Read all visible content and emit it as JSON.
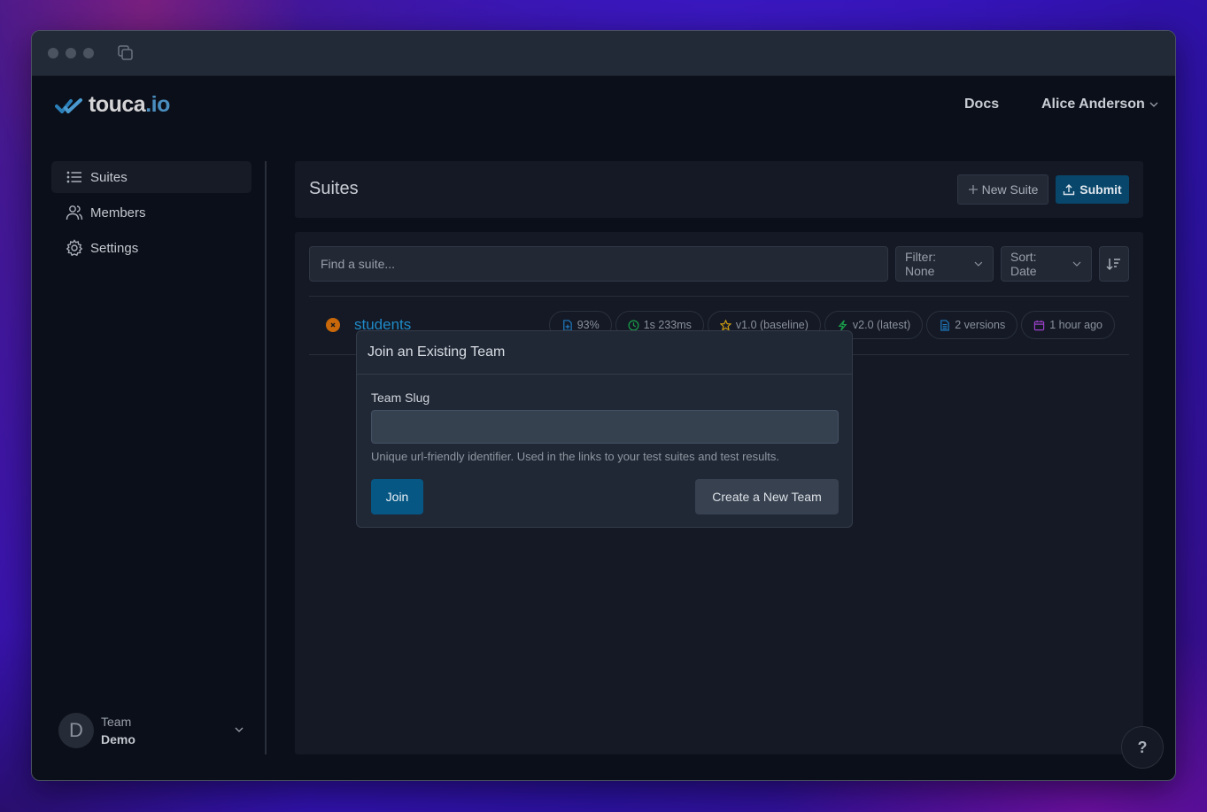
{
  "app": {
    "logo_word": "touca",
    "logo_tld": ".io"
  },
  "topnav": {
    "docs": "Docs",
    "user": "Alice Anderson"
  },
  "sidebar": {
    "items": [
      {
        "label": "Suites",
        "icon": "list-icon",
        "active": true
      },
      {
        "label": "Members",
        "icon": "users-icon",
        "active": false
      },
      {
        "label": "Settings",
        "icon": "gear-icon",
        "active": false
      }
    ],
    "team": {
      "avatar_letter": "D",
      "label": "Team",
      "name": "Demo"
    }
  },
  "main": {
    "title": "Suites",
    "new_suite_label": "New Suite",
    "submit_label": "Submit",
    "search_placeholder": "Find a suite...",
    "filter_label": "Filter: None",
    "sort_label": "Sort: Date",
    "suites": [
      {
        "name": "students",
        "status": "failed",
        "score": "93%",
        "duration": "1s 233ms",
        "baseline": "v1.0 (baseline)",
        "latest": "v2.0 (latest)",
        "versions": "2 versions",
        "updated": "1 hour ago"
      }
    ]
  },
  "modal": {
    "title": "Join an Existing Team",
    "field_label": "Team Slug",
    "field_value": "",
    "field_help": "Unique url-friendly identifier. Used in the links to your test suites and test results.",
    "join_label": "Join",
    "create_label": "Create a New Team"
  },
  "help_label": "?",
  "colors": {
    "accent": "#08476b",
    "link": "#1f8ac7",
    "status_failed": "#c8680a"
  }
}
